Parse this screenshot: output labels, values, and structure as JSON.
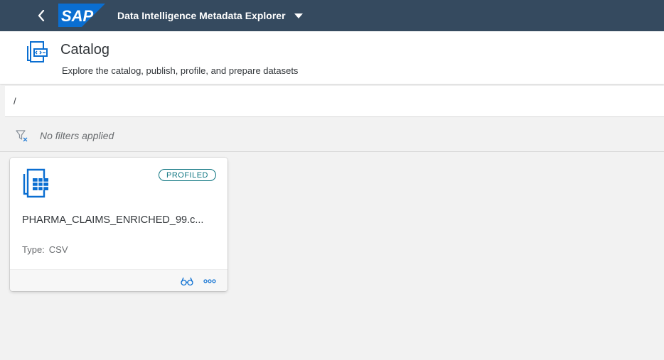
{
  "shellbar": {
    "logo_text": "SAP",
    "app_title": "Data Intelligence Metadata Explorer",
    "colors": {
      "background": "#354a5f",
      "logo": "#0a6ed1"
    }
  },
  "header": {
    "title": "Catalog",
    "subtitle": "Explore the catalog, publish, profile, and prepare datasets"
  },
  "path": {
    "value": "/"
  },
  "filters": {
    "status_text": "No filters applied"
  },
  "datasets": [
    {
      "name": "PHARMA_CLAIMS_ENRICHED_99.c...",
      "status_badge": "PROFILED",
      "type_label": "Type:",
      "type_value": "CSV",
      "icon": "csv-file-icon",
      "actions": [
        "preview-icon",
        "more-icon"
      ]
    }
  ],
  "colors": {
    "accent": "#0a6ed1",
    "badge": "#0e7581",
    "page_background": "#f2f2f2"
  }
}
